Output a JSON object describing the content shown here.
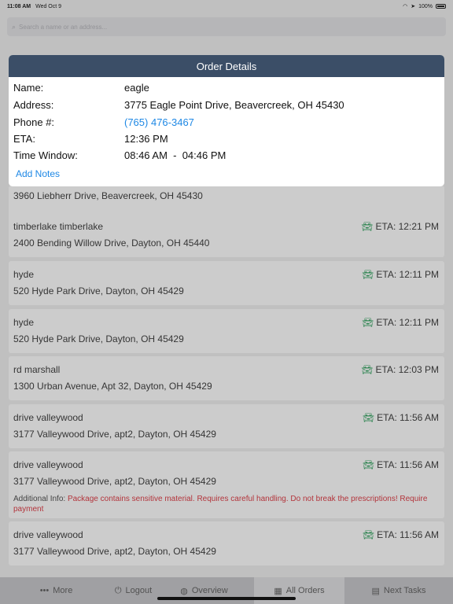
{
  "status_bar": {
    "time": "11:08 AM",
    "date": "Wed Oct 9",
    "battery": "100%"
  },
  "search": {
    "placeholder": "Search a name or an address..."
  },
  "orders": [
    {
      "name": "",
      "address": "3960 Liebherr Drive, Beavercreek, OH 45430",
      "eta": ""
    },
    {
      "name": "timberlake timberlake",
      "address": "2400 Bending Willow Drive, Dayton, OH 45440",
      "eta": "ETA: 12:21 PM"
    },
    {
      "name": "hyde",
      "address": "520 Hyde Park Drive, Dayton, OH 45429",
      "eta": "ETA: 12:11 PM"
    },
    {
      "name": "hyde",
      "address": "520 Hyde Park Drive, Dayton, OH 45429",
      "eta": "ETA: 12:11 PM"
    },
    {
      "name": "rd marshall",
      "address": "1300 Urban Avenue, Apt 32, Dayton, OH 45429",
      "eta": "ETA: 12:03 PM"
    },
    {
      "name": "drive valleywood",
      "address": "3177 Valleywood Drive, apt2, Dayton, OH 45429",
      "eta": "ETA: 11:56 AM"
    },
    {
      "name": "drive valleywood",
      "address": "3177 Valleywood Drive, apt2, Dayton, OH 45429",
      "eta": "ETA: 11:56 AM",
      "info_label": "Additional Info: ",
      "info_text": "Package contains sensitive material. Requires careful handling. Do not break the prescriptions! Require payment"
    },
    {
      "name": "drive valleywood",
      "address": "3177 Valleywood Drive, apt2, Dayton, OH 45429",
      "eta": "ETA: 11:56 AM"
    }
  ],
  "modal": {
    "title": "Order Details",
    "name_label": "Name:",
    "name_value": "eagle",
    "address_label": "Address:",
    "address_value": "3775 Eagle Point Drive, Beavercreek, OH 45430",
    "phone_label": "Phone #:",
    "phone_value": "(765) 476-3467",
    "eta_label": "ETA:",
    "eta_value": "12:36 PM",
    "window_label": "Time Window:",
    "window_value": "08:46 AM  -  04:46 PM",
    "add_notes": "Add Notes"
  },
  "tabs": [
    {
      "label": "More",
      "icon": "more-dots-icon"
    },
    {
      "label": "Logout",
      "icon": "power-icon"
    },
    {
      "label": "Overview",
      "icon": "globe-icon"
    },
    {
      "label": "All Orders",
      "icon": "building-icon",
      "active": true
    },
    {
      "label": "Next Tasks",
      "icon": "list-icon"
    }
  ],
  "colors": {
    "header": "#3b4e67",
    "link": "#1e88e5",
    "eta_car": "#3fa96a",
    "info_red": "#e0434c"
  }
}
